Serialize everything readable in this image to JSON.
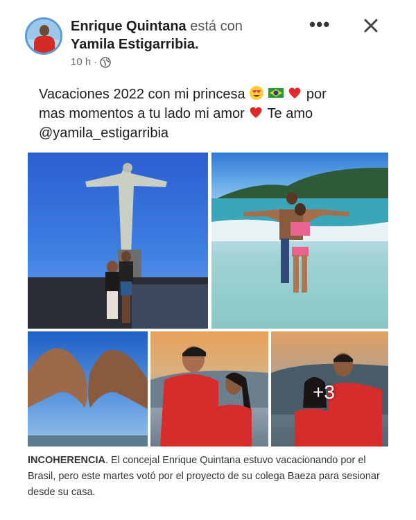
{
  "post": {
    "author": "Enrique Quintana",
    "with_text": "está con",
    "tagged_user": "Yamila Estigarribia",
    "tagged_suffix": ".",
    "time": "10 h",
    "time_sep": "·",
    "caption_line1": "Vacaciones 2022 con mi princesa",
    "caption_line1_end": "por",
    "caption_line2": "mas momentos a tu lado mi amor",
    "caption_line2_end": "Te amo",
    "caption_mention": "@yamila_estigarribia",
    "more_photos": "+3",
    "icons": [
      "globe-icon",
      "more-options-icon",
      "close-icon",
      "heart-eyes-emoji-icon",
      "brazil-flag-emoji-icon",
      "red-heart-emoji-icon"
    ]
  },
  "note": {
    "bold": "INCOHERENCIA",
    "text": ". El concejal Enrique Quintana estuvo vacacionando por el Brasil, pero este martes votó por el proyecto de su colega Baeza para sesionar desde su casa."
  }
}
